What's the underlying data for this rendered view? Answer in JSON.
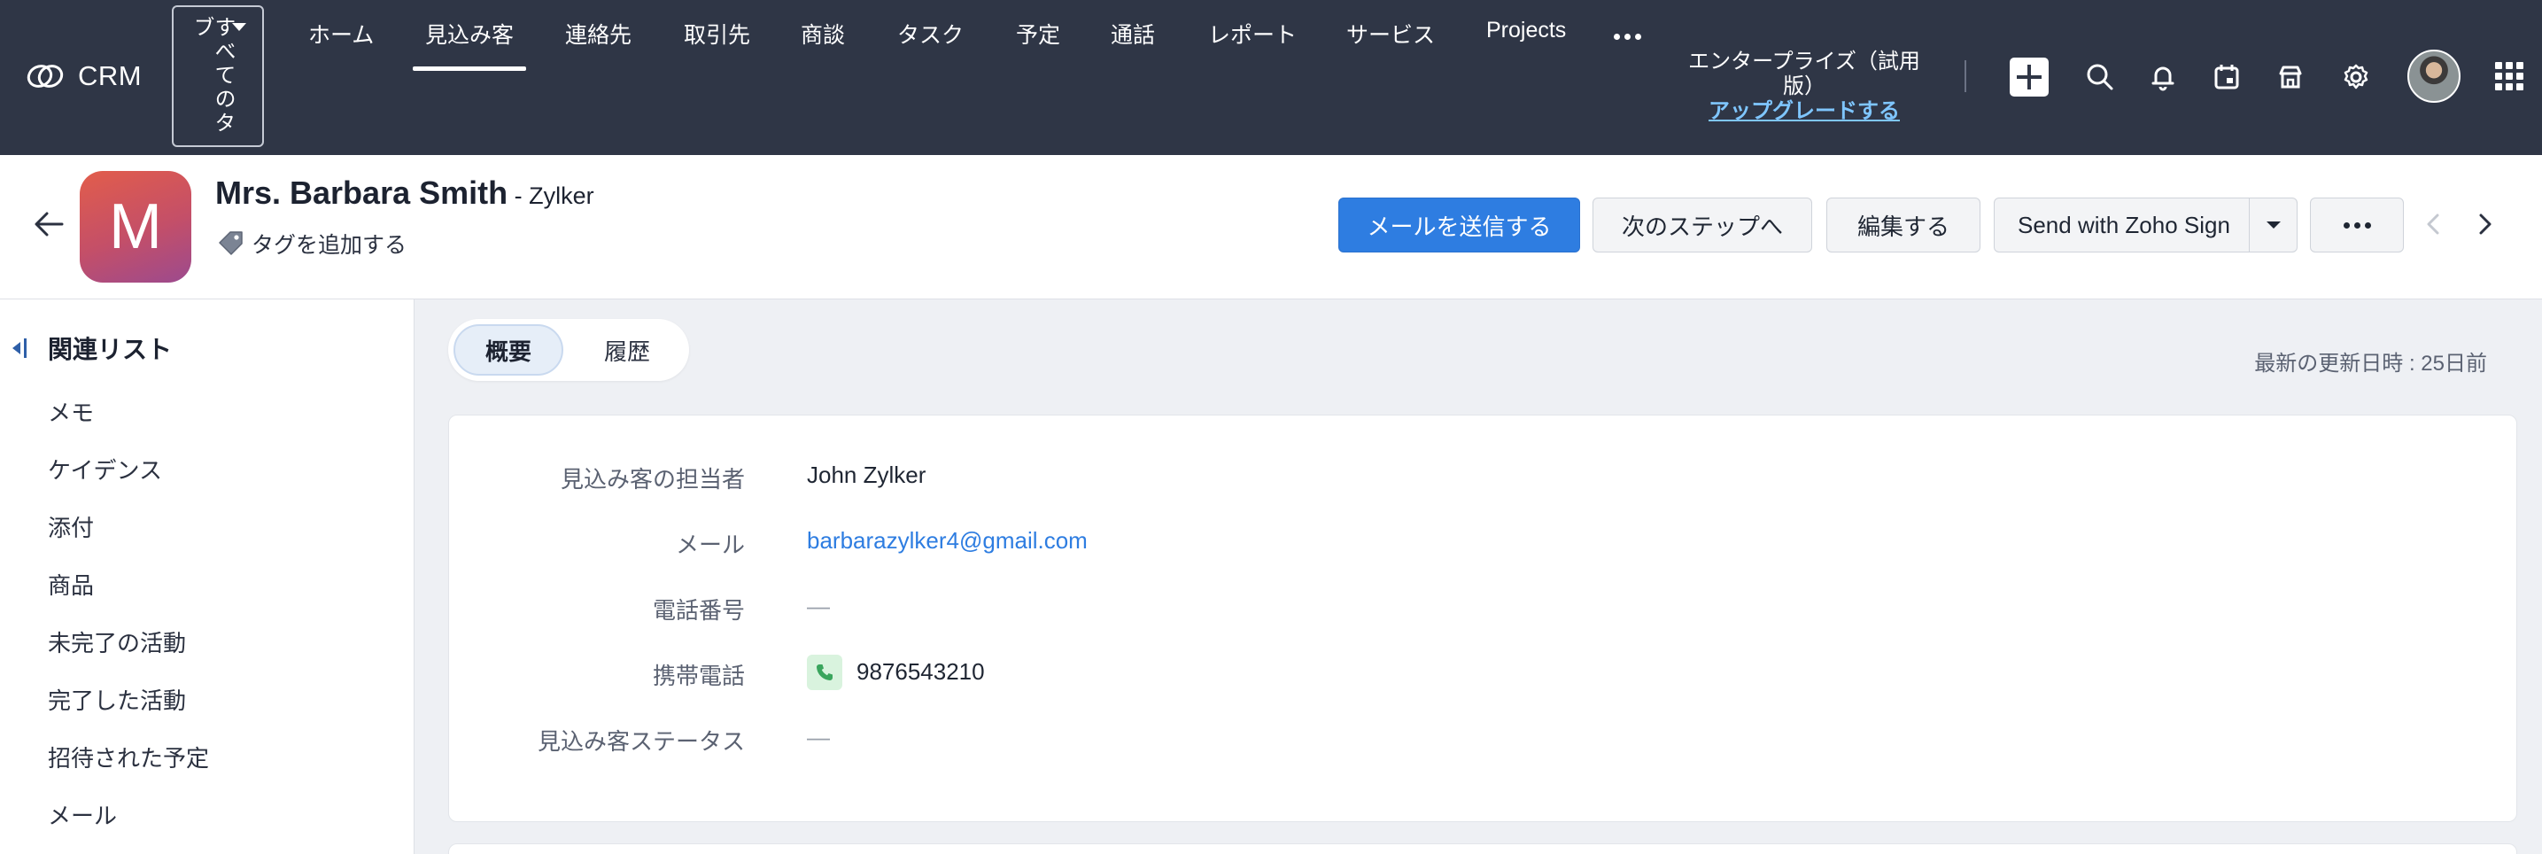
{
  "app": {
    "name": "CRM"
  },
  "topnav": {
    "all_tabs_label": "すべてのタブ",
    "items": [
      {
        "label": "ホーム"
      },
      {
        "label": "見込み客"
      },
      {
        "label": "連絡先"
      },
      {
        "label": "取引先"
      },
      {
        "label": "商談"
      },
      {
        "label": "タスク"
      },
      {
        "label": "予定"
      },
      {
        "label": "通話"
      },
      {
        "label": "レポート"
      },
      {
        "label": "サービス"
      },
      {
        "label": "Projects"
      }
    ],
    "active_index": 1,
    "edition": "エンタープライズ（試用版）",
    "upgrade_link": "アップグレードする",
    "icons": [
      "plus-icon",
      "search-icon",
      "bell-icon",
      "calendar-icon",
      "marketplace-icon",
      "gear-icon",
      "avatar",
      "apps-grid-icon"
    ]
  },
  "record": {
    "avatar_letter": "M",
    "name": "Mrs. Barbara Smith",
    "company": " - Zylker",
    "add_tag": "タグを追加する",
    "buttons": {
      "send_email": "メールを送信する",
      "next_step": "次のステップへ",
      "edit": "編集する",
      "zoho_sign": "Send with Zoho Sign"
    }
  },
  "sidebar": {
    "title": "関連リスト",
    "items": [
      "メモ",
      "ケイデンス",
      "添付",
      "商品",
      "未完了の活動",
      "完了した活動",
      "招待された予定",
      "メール"
    ]
  },
  "tabs": [
    {
      "label": "概要",
      "active": true
    },
    {
      "label": "履歴",
      "active": false
    }
  ],
  "last_updated": "最新の更新日時 : 25日前",
  "fields": [
    {
      "label": "見込み客の担当者",
      "value": "John Zylker",
      "type": "text"
    },
    {
      "label": "メール",
      "value": "barbarazylker4@gmail.com",
      "type": "link"
    },
    {
      "label": "電話番号",
      "value": "—",
      "type": "empty"
    },
    {
      "label": "携帯電話",
      "value": "9876543210",
      "type": "phone"
    },
    {
      "label": "見込み客ステータス",
      "value": "—",
      "type": "empty"
    }
  ],
  "colors": {
    "topbar": "#2f3646",
    "primary": "#2e7de1",
    "avatar_gradient_start": "#e25d4b",
    "avatar_gradient_end": "#9c4a8e"
  }
}
